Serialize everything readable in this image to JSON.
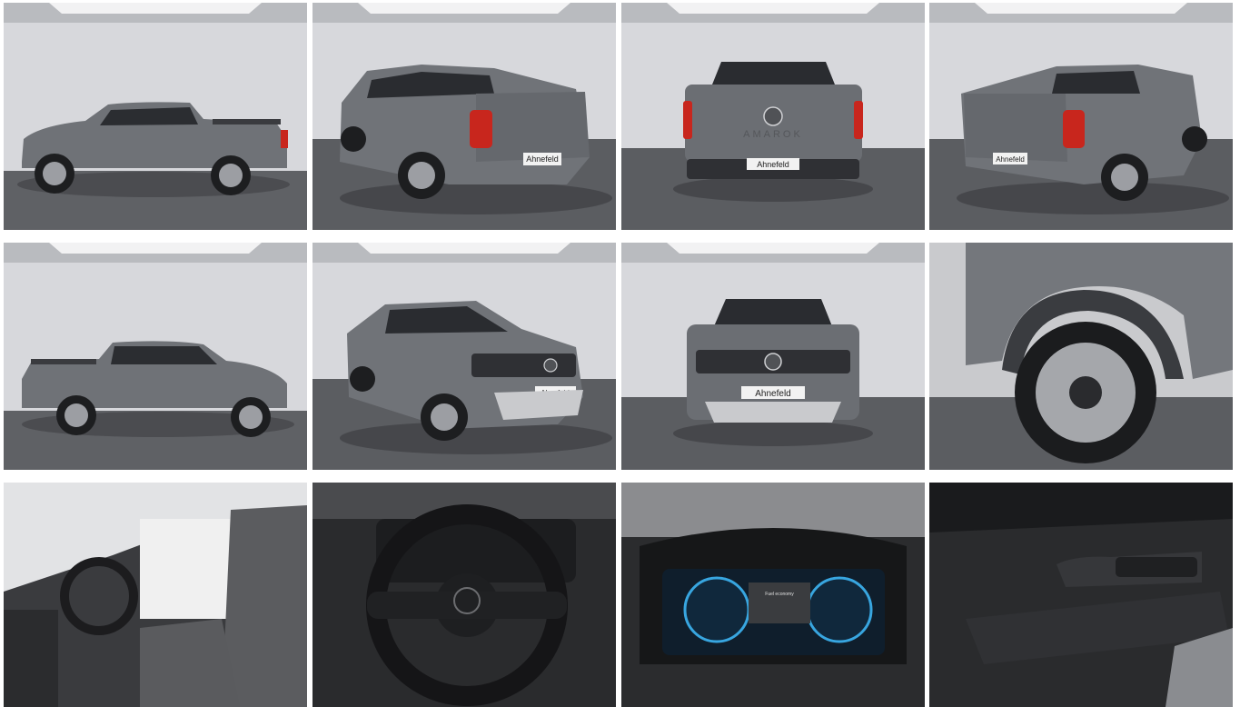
{
  "gallery": {
    "plate_text": "Ahnefeld",
    "model_text": "AMAROK",
    "cluster_message": "Fuel economy",
    "images": [
      {
        "icon": "car-side-left-photo"
      },
      {
        "icon": "car-rear-three-quarter-left-photo"
      },
      {
        "icon": "car-rear-photo"
      },
      {
        "icon": "car-rear-three-quarter-right-photo"
      },
      {
        "icon": "car-side-right-photo"
      },
      {
        "icon": "car-front-three-quarter-photo"
      },
      {
        "icon": "car-front-photo"
      },
      {
        "icon": "wheel-closeup-photo"
      },
      {
        "icon": "interior-front-seats-photo"
      },
      {
        "icon": "steering-wheel-photo"
      },
      {
        "icon": "instrument-cluster-photo"
      },
      {
        "icon": "door-panel-photo"
      }
    ]
  },
  "colors": {
    "body": "#6f7277",
    "studio_wall": "#d8d9dd",
    "studio_floor": "#5b5d61",
    "tail_light": "#c8261d",
    "cluster_blue": "#38a6e0"
  }
}
